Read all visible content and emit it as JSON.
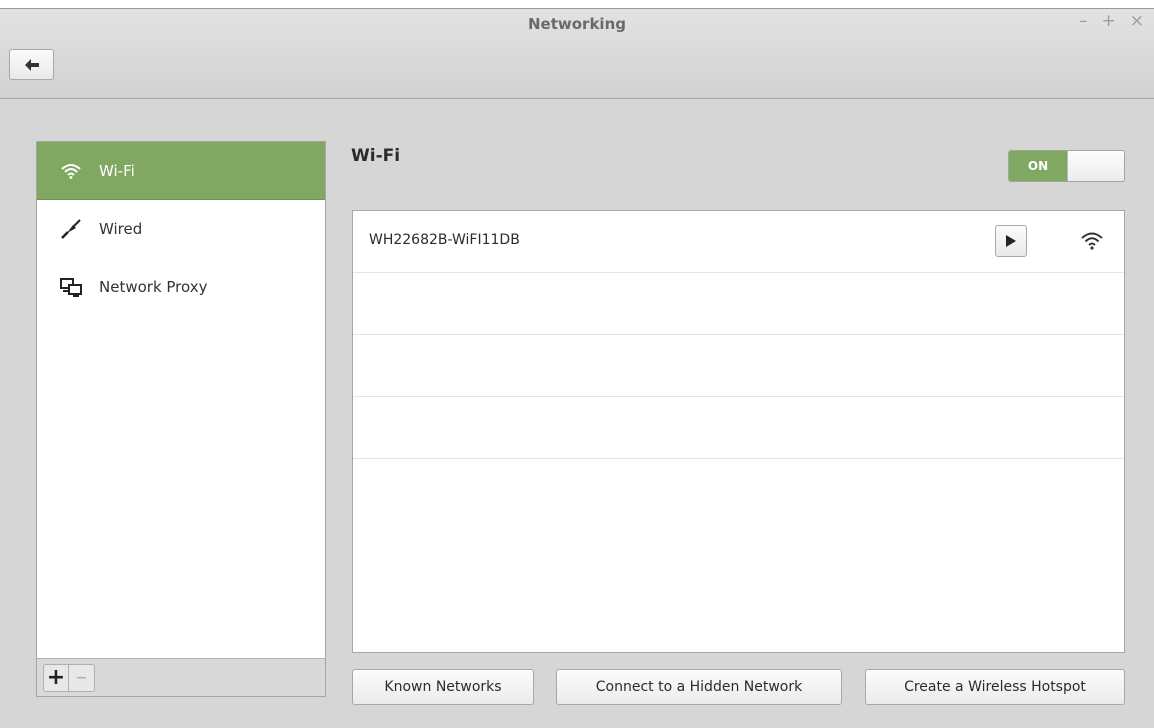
{
  "window": {
    "title": "Networking",
    "controls": {
      "minimize": "–",
      "maximize": "+",
      "close": "×"
    }
  },
  "sidebar": {
    "items": [
      {
        "label": "Wi-Fi",
        "icon": "wifi-icon",
        "active": true
      },
      {
        "label": "Wired",
        "icon": "ethernet-plug-icon",
        "active": false
      },
      {
        "label": "Network Proxy",
        "icon": "network-proxy-icon",
        "active": false
      }
    ],
    "add_label": "+",
    "remove_label": "–"
  },
  "main": {
    "heading": "Wi-Fi",
    "toggle": {
      "label": "ON",
      "state": true
    },
    "networks": [
      {
        "ssid": "WH22682B-WiFI11DB",
        "icon": "wifi-signal-icon"
      }
    ],
    "buttons": {
      "known": "Known Networks",
      "hidden": "Connect to a Hidden Network",
      "hotspot": "Create a Wireless Hotspot"
    }
  },
  "colors": {
    "accent": "#80a863",
    "window_bg": "#d6d6d6"
  }
}
